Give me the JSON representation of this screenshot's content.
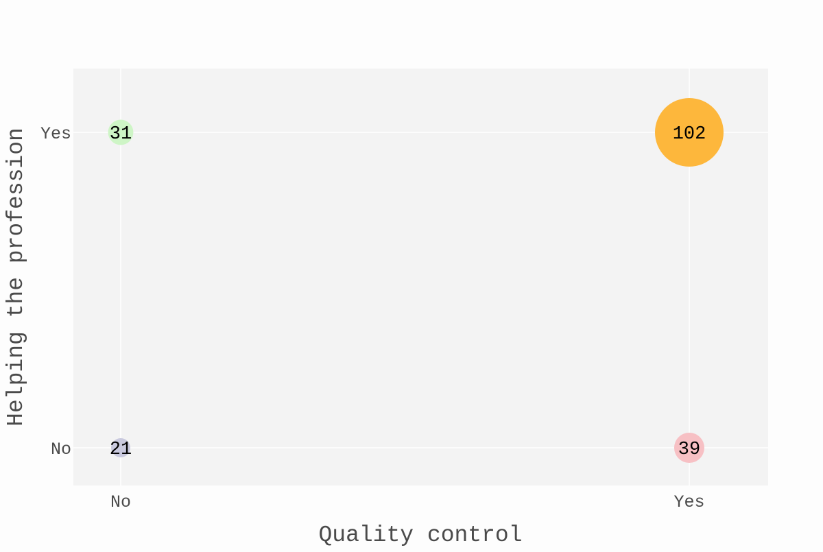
{
  "chart_data": {
    "type": "scatter",
    "xlabel": "Quality control",
    "ylabel": "Helping the profession",
    "x_categories": [
      "No",
      "Yes"
    ],
    "y_categories": [
      "No",
      "Yes"
    ],
    "grid": true,
    "points": [
      {
        "x": "No",
        "y": "Yes",
        "value": 31,
        "color": "#cef5c6"
      },
      {
        "x": "Yes",
        "y": "Yes",
        "value": 102,
        "color": "#fdb73c"
      },
      {
        "x": "No",
        "y": "No",
        "value": 21,
        "color": "#c9c9de"
      },
      {
        "x": "Yes",
        "y": "No",
        "value": 39,
        "color": "#f7c0c4"
      }
    ],
    "colors": {
      "background": "#fdfdfd",
      "panel": "#f3f3f3",
      "grid": "#ffffff",
      "text": "#4a4a4a",
      "label_text": "#000000"
    }
  }
}
